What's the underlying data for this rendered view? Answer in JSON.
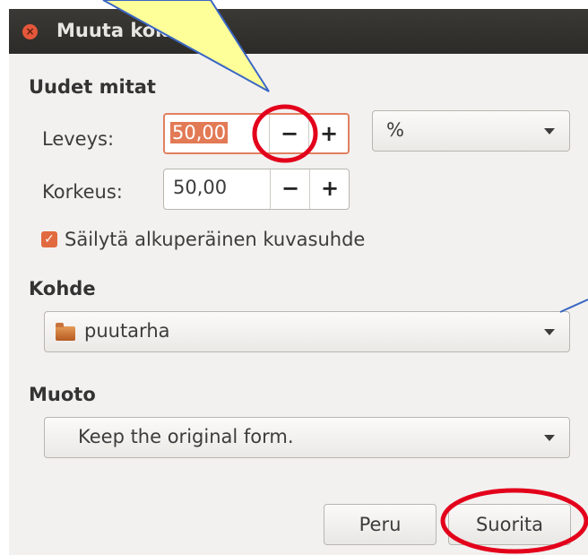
{
  "window": {
    "title": "Muuta koko",
    "close_glyph": "×"
  },
  "sections": {
    "new_dimensions": "Uudet mitat",
    "target": "Kohde",
    "format": "Muoto"
  },
  "width": {
    "label": "Leveys:",
    "value": "50,00",
    "minus": "−",
    "plus": "+"
  },
  "height": {
    "label": "Korkeus:",
    "value": "50,00",
    "minus": "−",
    "plus": "+"
  },
  "unit": {
    "selected": "%"
  },
  "keep_aspect": {
    "label": "Säilytä alkuperäinen kuvasuhde",
    "checked": true,
    "check_glyph": "✓"
  },
  "target": {
    "selected": "puutarha",
    "icon": "folder-icon"
  },
  "format": {
    "selected": "Keep the original form."
  },
  "buttons": {
    "cancel": "Peru",
    "apply": "Suorita"
  },
  "colors": {
    "accent": "#e27a55",
    "annotation_red": "#e3001b",
    "callout_yellow": "#ffff99",
    "callout_border": "#3a66c4"
  }
}
